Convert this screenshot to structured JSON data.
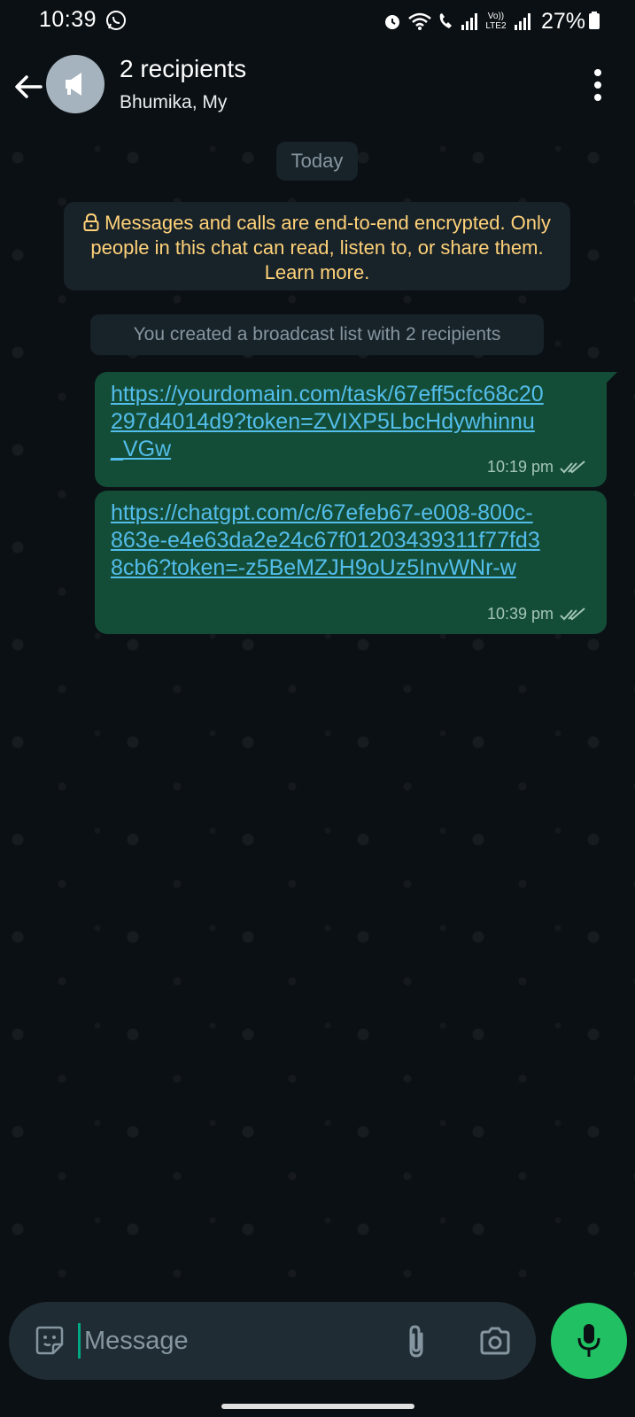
{
  "status_bar": {
    "time": "10:39",
    "battery": "27%",
    "network_label": "Vo)) LTE2"
  },
  "header": {
    "title": "2 recipients",
    "subtitle": "Bhumika, My"
  },
  "chat": {
    "date_label": "Today",
    "encryption_notice": "Messages and calls are end-to-end encrypted. Only people in this chat can read, listen to, or share them. Learn more.",
    "system_message": "You created a broadcast list with 2 recipients",
    "messages": [
      {
        "text": "https://yourdomain.com/task/67eff5cfc68c20297d4014d9?token=ZVIXP5LbcHdywhinnu_VGw",
        "time": "10:19 pm",
        "status": "delivered"
      },
      {
        "text": "https://chatgpt.com/c/67efeb67-e008-800c-863e-e4e63da2e24c67f01203439311f77fd38cb6?token=-z5BeMZJH9oUz5InvWNr-w",
        "time": "10:39 pm",
        "status": "delivered"
      }
    ]
  },
  "composer": {
    "placeholder": "Message"
  },
  "colors": {
    "background": "#0b1014",
    "outgoing_bubble": "#144d37",
    "link": "#53bdeb",
    "accent_green": "#21c063",
    "notice_text": "#ffd279"
  },
  "icons": [
    "whatsapp-icon",
    "alarm-icon",
    "wifi-icon",
    "call-icon",
    "signal-icon",
    "battery-icon",
    "back-arrow-icon",
    "broadcast-megaphone-icon",
    "more-vert-icon",
    "lock-icon",
    "double-tick-icon",
    "sticker-icon",
    "attach-icon",
    "camera-icon",
    "mic-icon"
  ]
}
